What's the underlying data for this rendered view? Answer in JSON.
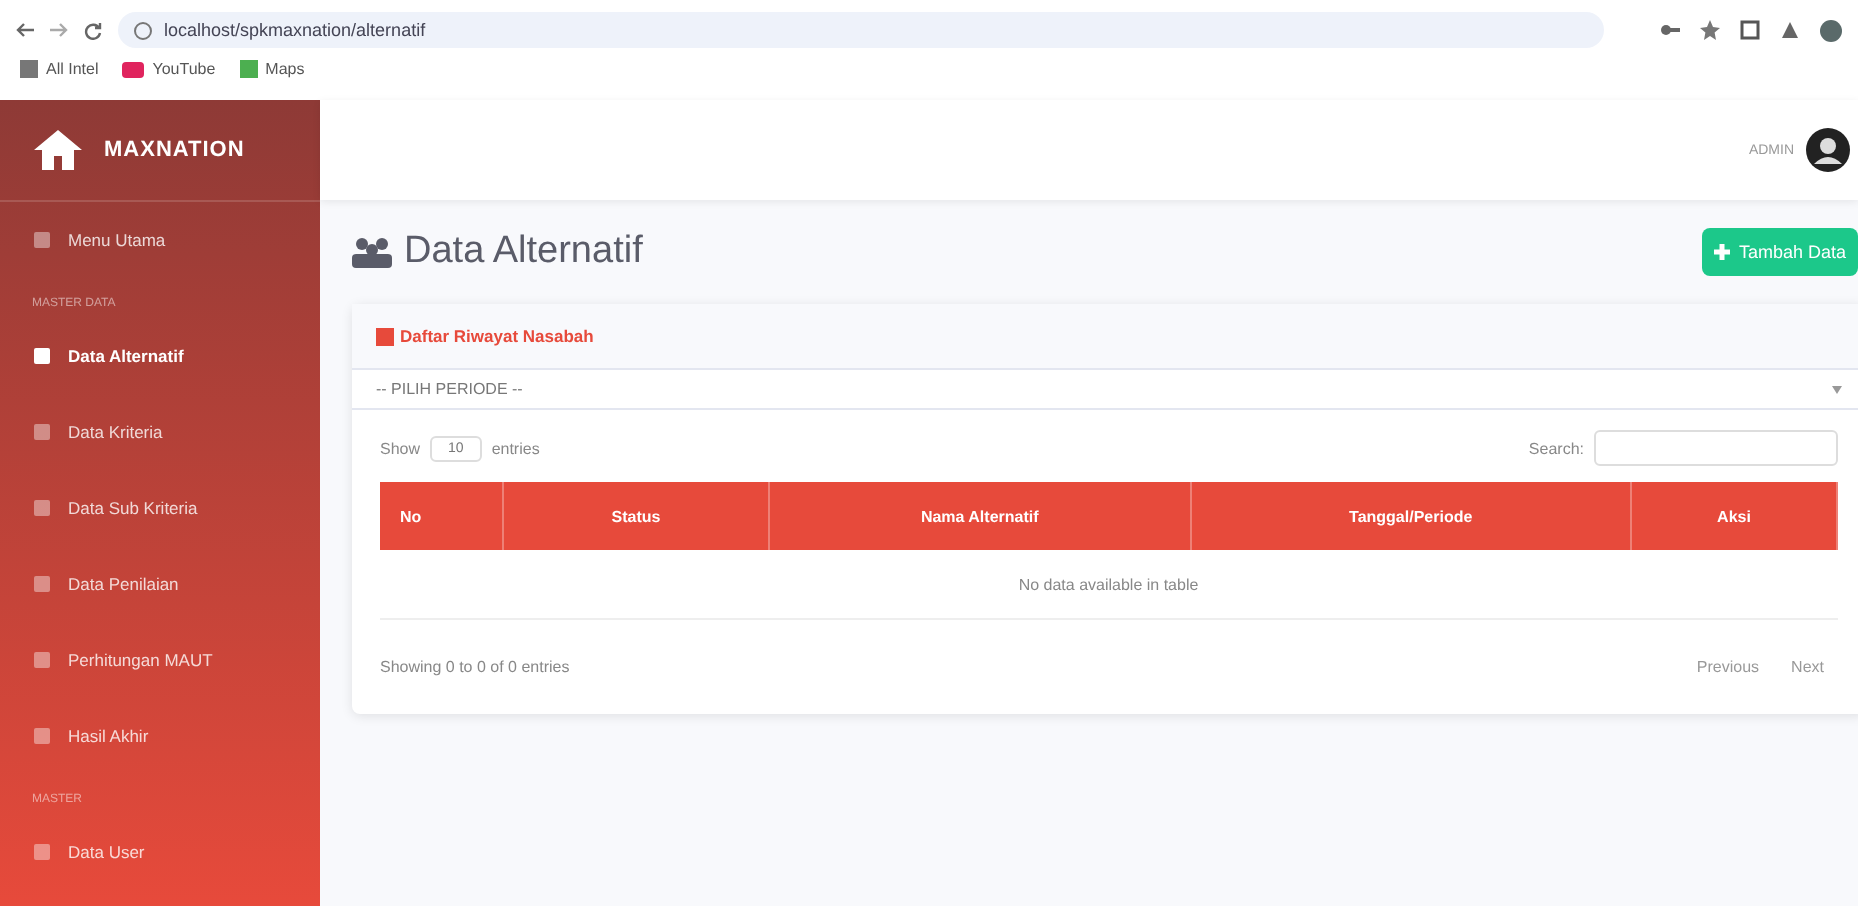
{
  "browser": {
    "url": "localhost/spkmaxnation/alternatif",
    "bookmarks": [
      {
        "label": "All Intel",
        "kind": "apps"
      },
      {
        "label": "YouTube",
        "kind": "youtube"
      },
      {
        "label": "Maps",
        "kind": "maps"
      }
    ]
  },
  "sidebar": {
    "brand": "MAXNATION",
    "items": [
      {
        "kind": "item",
        "label": "Menu Utama",
        "selected": false
      },
      {
        "kind": "heading",
        "label": "MASTER DATA"
      },
      {
        "kind": "item",
        "label": "Data Alternatif",
        "selected": true
      },
      {
        "kind": "item",
        "label": "Data Kriteria",
        "selected": false
      },
      {
        "kind": "item",
        "label": "Data Sub Kriteria",
        "selected": false
      },
      {
        "kind": "item",
        "label": "Data Penilaian",
        "selected": false
      },
      {
        "kind": "item",
        "label": "Perhitungan MAUT",
        "selected": false
      },
      {
        "kind": "item",
        "label": "Hasil Akhir",
        "selected": false
      },
      {
        "kind": "heading",
        "label": "MASTER"
      },
      {
        "kind": "item",
        "label": "Data User",
        "selected": false
      }
    ]
  },
  "topbar": {
    "user": "ADMIN"
  },
  "page": {
    "title": "Data Alternatif",
    "add_button": "Tambah Data"
  },
  "card": {
    "title": "Daftar Riwayat Nasabah",
    "period_select": "-- PILIH PERIODE --",
    "show_label": "Show",
    "page_size": "10",
    "entries_label": "entries",
    "search_label": "Search:",
    "table": {
      "columns": [
        "No",
        "Status",
        "Nama Alternatif",
        "Tanggal/Periode",
        "Aksi"
      ],
      "empty": "No data available in table"
    },
    "info": "Showing 0 to 0 of 0 entries",
    "pager": [
      "Previous",
      "Next"
    ]
  }
}
